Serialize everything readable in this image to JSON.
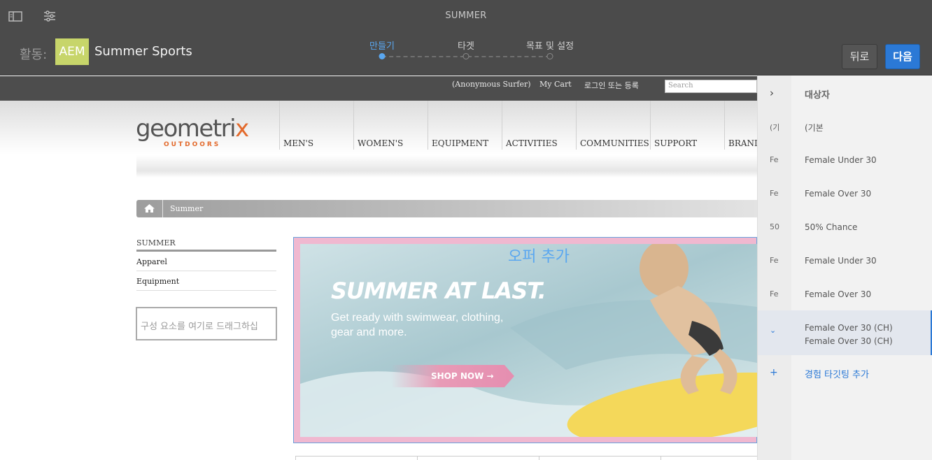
{
  "appbar": {
    "title": "SUMMER",
    "activity_label": "활동:",
    "aem_badge": "AEM",
    "activity_name": "Summer Sports",
    "steps": [
      {
        "label": "만들기",
        "active": true
      },
      {
        "label": "타겟",
        "active": false
      },
      {
        "label": "목표 및 설정",
        "active": false
      }
    ],
    "back_label": "뒤로",
    "next_label": "다음",
    "icons": [
      "sidebar-toggle-icon",
      "properties-icon"
    ]
  },
  "site": {
    "top_links": [
      "(Anonymous Surfer)",
      "My Cart",
      "로그인 또는 등록"
    ],
    "search_placeholder": "Search",
    "logo_text": "geometri",
    "logo_x": "x",
    "logo_sub": "OUTDOORS",
    "nav": [
      "MEN'S",
      "WOMEN'S",
      "EQUIPMENT",
      "ACTIVITIES",
      "COMMUNITIES",
      "SUPPORT",
      "BRAND"
    ],
    "breadcrumb": "Summer",
    "left_heading": "SUMMER",
    "left_links": [
      "Apparel",
      "Equipment"
    ],
    "dropzone": "구성 요소를 여기로 드래그하십",
    "offer_label": "오퍼 추가",
    "banner": {
      "title": "SUMMER AT LAST.",
      "subtitle": "Get ready with swimwear, clothing, gear and more.",
      "cta": "SHOP NOW →"
    }
  },
  "panel": {
    "head": {
      "abbr": "›",
      "label": "대상자"
    },
    "rows": [
      {
        "abbr": "(기",
        "label": "(기본"
      },
      {
        "abbr": "Fe",
        "label": "Female Under 30"
      },
      {
        "abbr": "Fe",
        "label": "Female Over 30"
      },
      {
        "abbr": "50",
        "label": "50% Chance"
      },
      {
        "abbr": "Fe",
        "label": "Female Under 30"
      },
      {
        "abbr": "Fe",
        "label": "Female Over 30"
      }
    ],
    "selected": {
      "abbr": "⌄",
      "label": "Female Over 30 (CH)",
      "sublabel": "Female Over 30 (CH)"
    },
    "add": {
      "abbr": "+",
      "label": "경험 타깃팅 추가"
    }
  },
  "colors": {
    "accent": "#2b79d6",
    "step_active": "#5aa7f0",
    "brand_orange": "#e36a2c",
    "aem_badge": "#c7d56a"
  }
}
